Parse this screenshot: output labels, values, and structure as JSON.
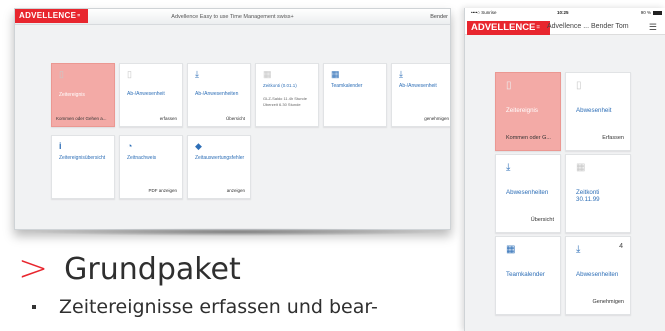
{
  "desktop": {
    "logo": "ADVELLENCE",
    "title": "Advellence Easy to use Time Management swiss+",
    "user": "Bender",
    "tiles": [
      {
        "title": "Zeitereignis",
        "footer": "Kommen oder Gehen a...",
        "icon": "document-icon"
      },
      {
        "title": "Ab-/Anwesenheit",
        "footer": "erfassen",
        "icon": "document-icon"
      },
      {
        "title": "Ab-/Anwesenheiten",
        "footer": "Übersicht",
        "icon": "download-icon"
      },
      {
        "title": "Zeitkonti (0.01.1)",
        "row1": "GLZ-Saldo    11.4h Stunde",
        "row2": "Überzeit       6.30 Stunde",
        "icon": "calendar-icon"
      },
      {
        "title": "Teamkalender",
        "footer": "",
        "icon": "calendar-grid-icon"
      },
      {
        "title": "Ab-/Anwesenheit",
        "footer": "genehmigen",
        "icon": "download-icon"
      },
      {
        "title": "Zeitereignisübersicht",
        "footer": "",
        "icon": "info-icon"
      },
      {
        "title": "Zeitnachweis",
        "footer": "PDF anzeigen",
        "icon": "clock-icon"
      },
      {
        "title": "Zeitauswertungsfehler",
        "footer": "anzeigen",
        "icon": "diamond-icon"
      }
    ]
  },
  "heading": "Grundpaket",
  "heading_marker": ">",
  "bullet": "Zeitereignisse erfassen und bear-",
  "phone": {
    "carrier": "••••○ Sunrise",
    "time": "10:25",
    "battery": "90 %",
    "logo": "ADVELLENCE",
    "title": "Advellence ... Bender Tom",
    "tiles": [
      {
        "title": "Zeitereignis",
        "footer": "Kommen oder G...",
        "icon": "document-icon"
      },
      {
        "title": "Abwesenheit",
        "footer": "Erfassen",
        "icon": "document-icon"
      },
      {
        "title": "Abwesenheiten",
        "footer": "Übersicht",
        "icon": "download-icon"
      },
      {
        "title": "Zeitkonti",
        "sub": "30.11.99",
        "icon": "calendar-icon"
      },
      {
        "title": "Teamkalender",
        "footer": "",
        "icon": "calendar-grid-icon"
      },
      {
        "title": "Abwesenheiten",
        "footer": "Genehmigen",
        "count": "4",
        "icon": "download-icon"
      }
    ]
  },
  "colors": {
    "brand": "#e8262e",
    "tile_highlight": "#f3aaa6",
    "link": "#2e6fb7"
  }
}
